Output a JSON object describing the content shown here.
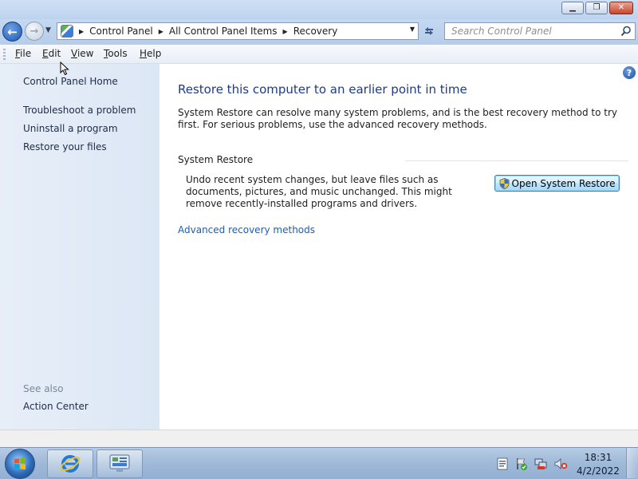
{
  "window": {
    "minimize_glyph": "▁",
    "maximize_glyph": "❐",
    "close_glyph": "✕"
  },
  "nav": {
    "back_glyph": "←",
    "forward_glyph": "→",
    "breadcrumb": [
      "Control Panel",
      "All Control Panel Items",
      "Recovery"
    ],
    "search_placeholder": "Search Control Panel"
  },
  "menu": {
    "items": [
      {
        "accel": "F",
        "rest": "ile"
      },
      {
        "accel": "E",
        "rest": "dit"
      },
      {
        "accel": "V",
        "rest": "iew"
      },
      {
        "accel": "T",
        "rest": "ools"
      },
      {
        "accel": "H",
        "rest": "elp"
      }
    ]
  },
  "sidebar": {
    "home": "Control Panel Home",
    "links": [
      "Troubleshoot a problem",
      "Uninstall a program",
      "Restore your files"
    ],
    "see_also_label": "See also",
    "see_also_links": [
      "Action Center"
    ]
  },
  "main": {
    "help_glyph": "?",
    "title": "Restore this computer to an earlier point in time",
    "description": "System Restore can resolve many system problems, and is the best recovery method to try first. For serious problems, use the advanced recovery methods.",
    "section_title": "System Restore",
    "section_description": "Undo recent system changes, but leave files such as documents, pictures, and music unchanged. This might remove recently-installed programs and drivers.",
    "open_button": "Open System Restore",
    "advanced_link": "Advanced recovery methods"
  },
  "taskbar": {
    "time": "18:31",
    "date": "4/2/2022"
  },
  "colors": {
    "title_blue": "#1e3a8a",
    "link_blue": "#1a5fb4",
    "sidebar_bg": "#e7eef8",
    "taskbar_bg": "#9fb9d9"
  }
}
